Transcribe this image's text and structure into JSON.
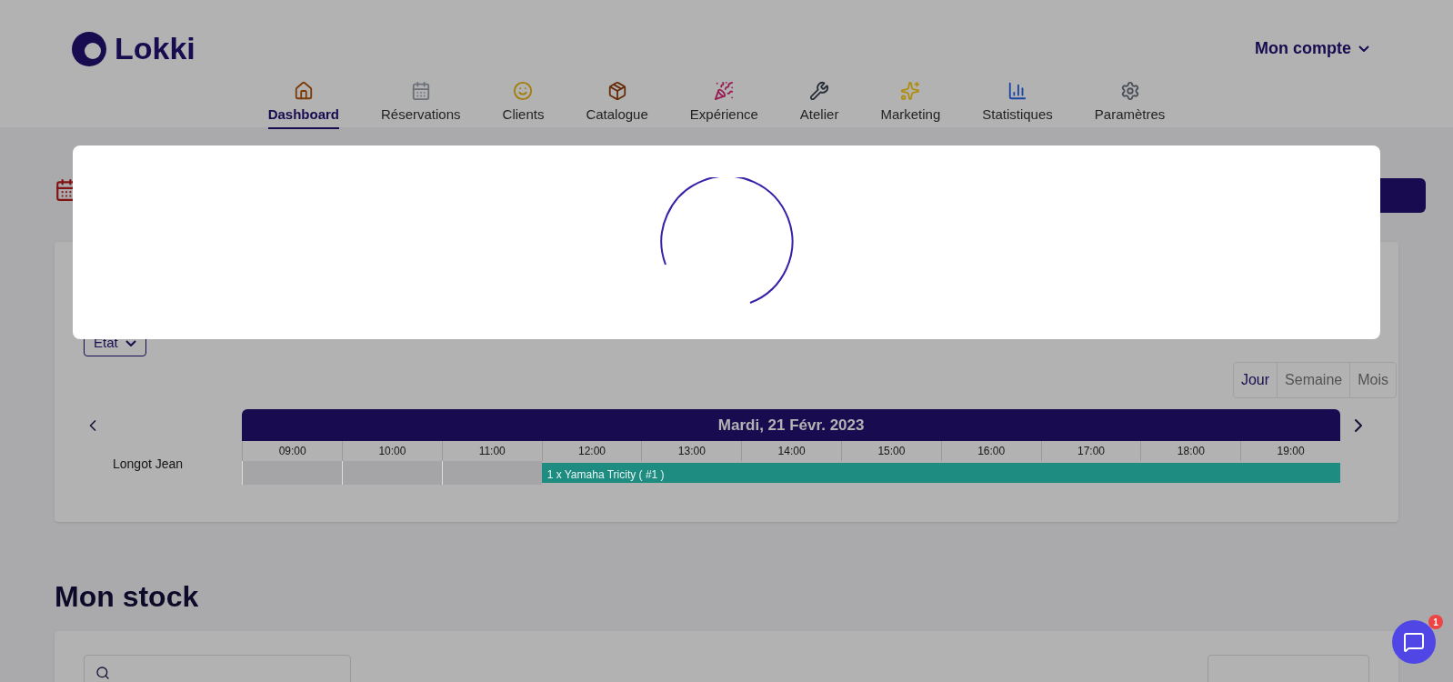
{
  "brand": {
    "name": "Lokki"
  },
  "account": {
    "label": "Mon compte"
  },
  "nav": [
    {
      "label": "Dashboard",
      "selected": true
    },
    {
      "label": "Réservations",
      "selected": false
    },
    {
      "label": "Clients",
      "selected": false
    },
    {
      "label": "Catalogue",
      "selected": false
    },
    {
      "label": "Expérience",
      "selected": false
    },
    {
      "label": "Atelier",
      "selected": false
    },
    {
      "label": "Marketing",
      "selected": false
    },
    {
      "label": "Statistiques",
      "selected": false
    },
    {
      "label": "Paramètres",
      "selected": false
    }
  ],
  "planning": {
    "filter": {
      "label": "Etat"
    },
    "views": [
      {
        "label": "Jour",
        "selected": true
      },
      {
        "label": "Semaine",
        "selected": false
      },
      {
        "label": "Mois",
        "selected": false
      }
    ],
    "date": "Mardi, 21 Févr. 2023",
    "hours": [
      "09:00",
      "10:00",
      "11:00",
      "12:00",
      "13:00",
      "14:00",
      "15:00",
      "16:00",
      "17:00",
      "18:00",
      "19:00"
    ],
    "rows": [
      {
        "name": "Longot Jean",
        "slots": [
          false,
          false,
          false,
          true,
          true,
          true,
          true,
          true,
          true,
          true,
          true
        ],
        "booking": "1 x Yamaha Tricity ( #1 )",
        "color": "#1e8c80"
      }
    ]
  },
  "stock": {
    "title": "Mon stock"
  },
  "loading": true,
  "chat": {
    "badge": "1"
  }
}
